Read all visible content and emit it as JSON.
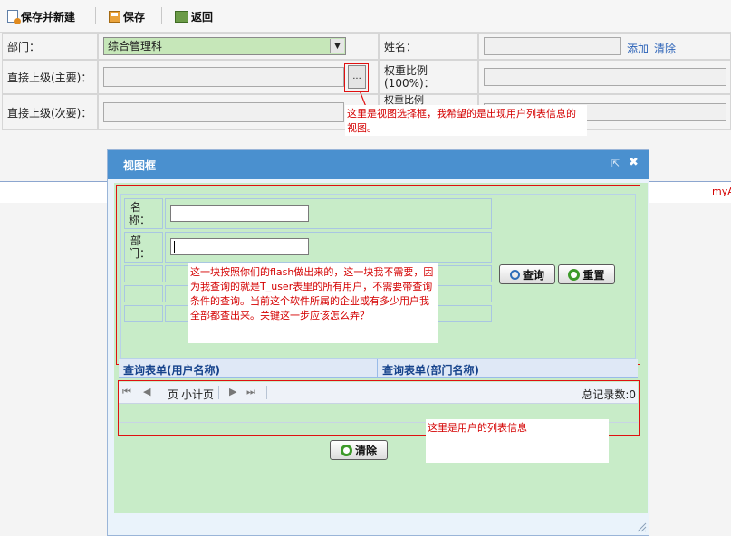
{
  "toolbar": {
    "save_new_label": "保存并新建",
    "save_label": "保存",
    "back_label": "返回"
  },
  "form": {
    "dept_label": "部门：",
    "dept_value": "综合管理科",
    "name_label": "姓名：",
    "add_link": "添加",
    "clear_link": "清除",
    "superior_main_label": "直接上级(主要)：",
    "picker_button": "...",
    "weight_label_line1": "权重比例",
    "weight_label_line2": "(100%)：",
    "superior_sub_label": "直接上级(次要)：",
    "weight_label_partial": "权重比例"
  },
  "band_text": "myA",
  "dialog": {
    "title": "视图框",
    "name_label_1": "名",
    "name_label_2": "称：",
    "dept_label_1": "部",
    "dept_label_2": "门：",
    "search_button": "查询",
    "reset_button": "重置",
    "col_user_name": "查询表单(用户名称)",
    "col_dept_name": "查询表单(部门名称)",
    "pager_page": "页",
    "pager_subtotal": "小计页",
    "total_records": "总记录数:0",
    "clear_button": "清除"
  },
  "annotations": {
    "picker_note": "这里是视图选择框，我希望的是出现用户列表信息的视图。",
    "search_note": "这一块按照你们的flash做出来的，这一块我不需要，因为我查询的就是T_user表里的所有用户，不需要带查询条件的查询。当前这个软件所属的企业或有多少用户我全部都查出来。关键这一步应该怎么弄？",
    "list_note": "这里是用户的列表信息"
  },
  "colors": {
    "dialog_header": "#4a90cf",
    "dialog_body": "#c8ecc8",
    "annotation_red": "#d40000",
    "link_blue": "#2c63b8"
  }
}
